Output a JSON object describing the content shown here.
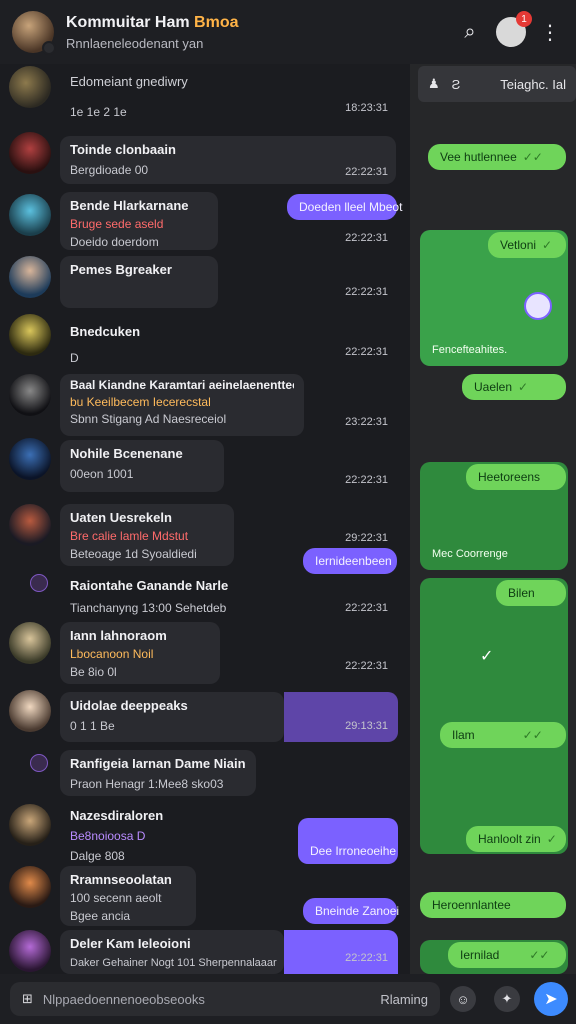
{
  "header": {
    "title_main": "Kommuitar Ham",
    "title_accent": "Bmoa",
    "subtitle": "Rnnlaeneleodenant yan",
    "notif_count": "1"
  },
  "left": {
    "rows": [
      {
        "name": "Edomeiant gnediwry",
        "line": "1e 1e 2 1e",
        "time": "18:23:31"
      },
      {
        "name": "Toinde clonbaain",
        "line": "Bergdioade 00",
        "time": "22:22:31"
      },
      {
        "name": "Bende Hlarkarnane",
        "line1": "Bruge sede aseld",
        "line2": "Doeido doerdom",
        "time": "22:22:31"
      },
      {
        "name": "Pemes Bgreaker",
        "line": "",
        "time": "22:22:31"
      },
      {
        "name": "Bnedcuken",
        "line": "D",
        "time": "22:22:31"
      },
      {
        "name": "Baal Kiandne Karamtari aeinelaenentteen",
        "line1": "bu Keeilbecem Iecerecstal",
        "line2": "Sbnn Stigang Ad Naesreceiol",
        "time": "23:22:31"
      },
      {
        "name": "Nohile Bcenenane",
        "line": "00eon 1001",
        "time": "22:22:31"
      },
      {
        "name": "Uaten Uesrekeln",
        "line1": "Bre calie lamle Mdstut",
        "line2": "Beteoage 1d Syoaldiedi",
        "time": "29:22:31"
      },
      {
        "name": "Raiontahe Ganande Narle",
        "line": "Tianchanyng 13:00 Sehetdeb",
        "time": "22:22:31"
      },
      {
        "name": "Iann lahnoraom",
        "line1": "Lbocanoon Noil",
        "line2": "Be 8io 0l",
        "time": "22:22:31"
      },
      {
        "name": "Uidolae deeppeaks",
        "line": "0 1 1 Be",
        "time": "29:13:31"
      },
      {
        "name": "Ranfigeia Iarnan Dame Niain",
        "line": "Praon Henagr 1:Mee8 sko03",
        "time": ""
      },
      {
        "name": "Nazesdiraloren",
        "line1": "Be8noioosa D",
        "line2": "Dalge 808",
        "time": ""
      },
      {
        "name": "Rramnseoolatan",
        "line1": "100 secenn aeolt",
        "line2": "Bgee ancia",
        "time": ""
      },
      {
        "name": "Deler Kam Ieleoioni",
        "line": "Daker Gehainer Nogt 101 Sherpennalaaar",
        "time": "22:22:31"
      }
    ],
    "pills": {
      "p1": "Doeden lleel Mbeot",
      "p2": "Iernideenbeen",
      "p3": "Dee Irroneoeihe",
      "p4": "Bneinde Zanoei"
    }
  },
  "right": {
    "tabs": [
      "Teiaghc. Ial"
    ],
    "messages": {
      "m1": "Vee hutlennee",
      "m2": "Vetloni",
      "m3": "Fencefteahites.",
      "m4": "Uaelen",
      "m5": "Heetoreens",
      "m6": "Mec Coorrenge",
      "m7": "Bilen",
      "m8": "Ilam",
      "m9": "Hanloolt zin",
      "m10": "Heroennlantee",
      "m11": "Iernilad"
    }
  },
  "composer": {
    "placeholder": "Nlppaedoennenoeobseooks",
    "hint": "Rlaming"
  }
}
